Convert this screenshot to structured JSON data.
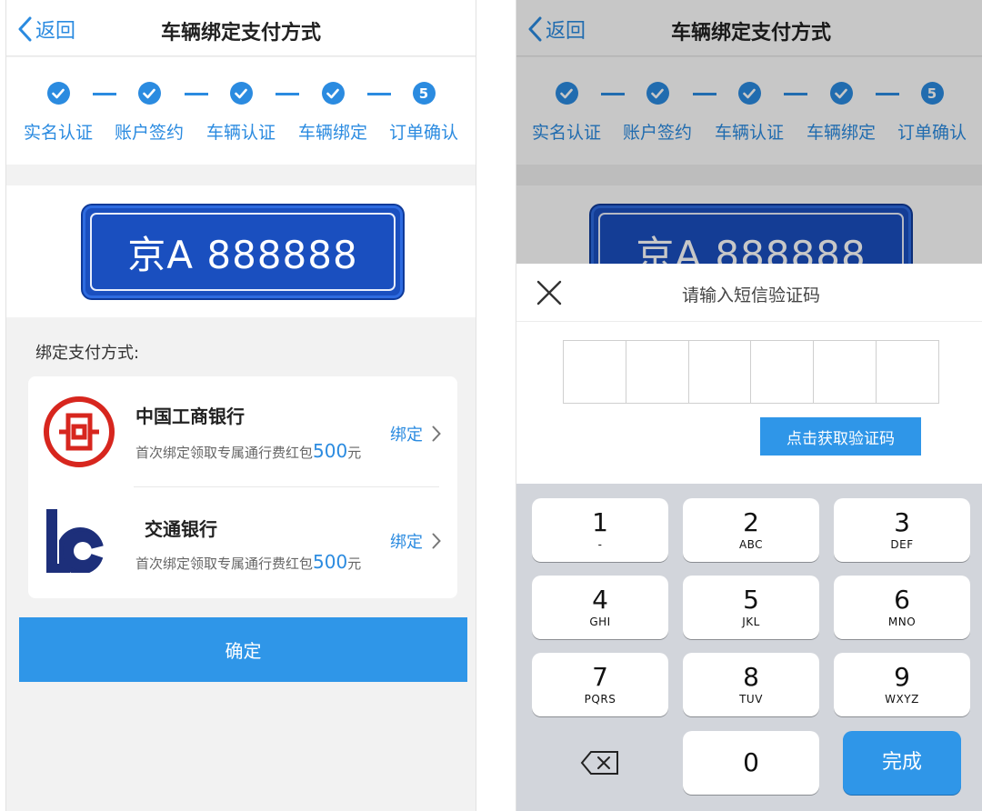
{
  "left": {
    "nav": {
      "back_label": "返回",
      "title": "车辆绑定支付方式"
    },
    "steps": [
      {
        "label": "实名认证",
        "state": "done"
      },
      {
        "label": "账户签约",
        "state": "done"
      },
      {
        "label": "车辆认证",
        "state": "done"
      },
      {
        "label": "车辆绑定",
        "state": "done"
      },
      {
        "label": "订单确认",
        "state": "current",
        "number": "5"
      }
    ],
    "plate": "京A 888888",
    "section_title": "绑定支付方式:",
    "banks": [
      {
        "name": "中国工商银行",
        "promo_prefix": "首次绑定领取专属通行费红包",
        "promo_amount": "500",
        "promo_unit": "元",
        "action": "绑定",
        "logo": "icbc-logo"
      },
      {
        "name": "交通银行",
        "promo_prefix": "首次绑定领取专属通行费红包",
        "promo_amount": "500",
        "promo_unit": "元",
        "action": "绑定",
        "logo": "bocom-logo"
      }
    ],
    "confirm_label": "确定"
  },
  "right": {
    "nav": {
      "back_label": "返回",
      "title": "车辆绑定支付方式"
    },
    "steps": [
      {
        "label": "实名认证"
      },
      {
        "label": "账户签约"
      },
      {
        "label": "车辆认证"
      },
      {
        "label": "车辆绑定"
      },
      {
        "label": "订单确认",
        "number": "5"
      }
    ],
    "plate": "京A 888888",
    "sheet": {
      "title": "请输入短信验证码",
      "code_digits": [
        "",
        "",
        "",
        "",
        "",
        ""
      ],
      "get_code_label": "点击获取验证码"
    },
    "keypad": {
      "keys": [
        {
          "digit": "1",
          "letters": ""
        },
        {
          "digit": "2",
          "letters": "ABC"
        },
        {
          "digit": "3",
          "letters": "DEF"
        },
        {
          "digit": "4",
          "letters": "GHI"
        },
        {
          "digit": "5",
          "letters": "JKL"
        },
        {
          "digit": "6",
          "letters": "MNO"
        },
        {
          "digit": "7",
          "letters": "PQRS"
        },
        {
          "digit": "8",
          "letters": "TUV"
        },
        {
          "digit": "9",
          "letters": "WXYZ"
        },
        {
          "digit": "0",
          "letters": ""
        }
      ],
      "done_label": "完成"
    }
  },
  "colors": {
    "accent": "#2b8be0",
    "plate_blue": "#1a4fbf",
    "button_blue": "#2f96e8",
    "icbc_red": "#d7261e",
    "bocom_navy": "#1d2f7a"
  }
}
